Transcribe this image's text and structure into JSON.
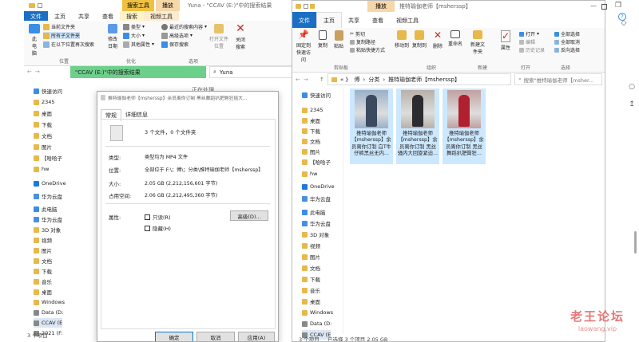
{
  "left_window": {
    "title": "Yuna - \"CCAV (E:)\"中的搜索结果",
    "context_tabs": [
      "搜索工具",
      "播放"
    ],
    "tabs": [
      "文件",
      "主页",
      "共享",
      "查看",
      "搜索",
      "视频工具"
    ],
    "ribbon": {
      "items_location": [
        "当前文件夹",
        "所有子文件夹",
        "在以下位置再次搜索"
      ],
      "computer": "此电脑",
      "items_refine": [
        "修改日期",
        "类型",
        "大小",
        "其他属性"
      ],
      "items_options": [
        "最近的搜索内容",
        "高级选项",
        "保存搜索"
      ],
      "open_location": "打开文件位置",
      "close_search": "关闭搜索",
      "groups": [
        "位置",
        "优化",
        "选项"
      ]
    },
    "address": "\"CCAV (E:)\"中的搜索结果",
    "search_value": "Yuna",
    "working_text": "正在处理...",
    "nav": [
      "快速访问",
      "2345",
      "桌面",
      "下载",
      "文档",
      "图片",
      "【哈哈子",
      "hw",
      "OneDrive",
      "华为云盘",
      "此电脑",
      "华为云盘",
      "3D 对象",
      "视频",
      "图片",
      "文档",
      "下载",
      "音乐",
      "桌面",
      "Windows",
      "Data (D:",
      "CCAV (E",
      "2021 (F:"
    ],
    "status": "3 个项目"
  },
  "properties": {
    "title": "推特瑜伽老师【msherssp】余员离你订制 黑丝舞蹈扒肥臀狂摇大...",
    "tabs": [
      "常规",
      "详细信息"
    ],
    "summary": "3 个文件，0 个文件夹",
    "rows": [
      {
        "label": "类型:",
        "value": "类型均为 MP4 文件"
      },
      {
        "label": "位置:",
        "value": "全部位于 F:\\；傅\\；分类\\推特瑜伽老师【msherssp】"
      },
      {
        "label": "大小:",
        "value": "2.05 GB (2,212,156,601 字节)"
      },
      {
        "label": "占用空间:",
        "value": "2.06 GB (2,212,495,360 字节)"
      }
    ],
    "attributes_label": "属性:",
    "readonly": "只读(R)",
    "hidden": "隐藏(H)",
    "advanced": "高级(D)...",
    "buttons": [
      "确定",
      "取消",
      "应用(A)"
    ]
  },
  "right_window": {
    "title": "推特瑜伽老师【msherssp】",
    "context_tab": "播放",
    "tabs": [
      "文件",
      "主页",
      "共享",
      "查看",
      "视频工具"
    ],
    "ribbon": {
      "pin": "固定到快速访问",
      "copy": "复制",
      "paste": "粘贴",
      "cut": "剪切",
      "copy_path": "复制路径",
      "paste_shortcut": "粘贴快捷方式",
      "move_to": "移动到",
      "copy_to": "复制到",
      "delete": "删除",
      "rename": "重命名",
      "new_folder": "新建文件夹",
      "properties": "属性",
      "open": "打开",
      "edit": "编辑",
      "history": "历史记录",
      "select_all": "全部选择",
      "select_none": "全部取消",
      "invert": "反向选择",
      "groups": [
        "剪贴板",
        "组织",
        "新建",
        "打开",
        "选择"
      ]
    },
    "path": [
      "傅",
      "分类",
      "推特瑜伽老师【msherssp】"
    ],
    "search_placeholder": "搜索\"推特瑜伽老师【msher...",
    "nav": [
      "快速访问",
      "2345",
      "桌面",
      "下载",
      "文档",
      "图片",
      "【哈哈子",
      "hw",
      "OneDrive",
      "华为云盘",
      "此电脑",
      "华为云盘",
      "3D 对象",
      "视频",
      "图片",
      "文档",
      "下载",
      "音乐",
      "桌面",
      "Windows",
      "Data (D:",
      "CCAV (E",
      "2021 (F:"
    ],
    "files": [
      "推特瑜伽老师【msherssp】余员离你订制 白T牛仔裤黑丝无内...",
      "推特瑜伽老师【msherssp】余员离你订制 黑丝骚内大回旋紧迫...",
      "推特瑜伽老师【msherssp】余员离你订制 黑丝舞蹈扒肥臀狂..."
    ],
    "status_count": "3 个项目",
    "status_selected": "已选择 3 个项目 2.05 GB"
  },
  "watermark": {
    "title": "老王论坛",
    "url": "laowang.vip"
  },
  "colors": {
    "accent": "#1a6fc4",
    "context": "#f0a818",
    "address_green": "#6cd08a",
    "watermark": "#e05050"
  }
}
